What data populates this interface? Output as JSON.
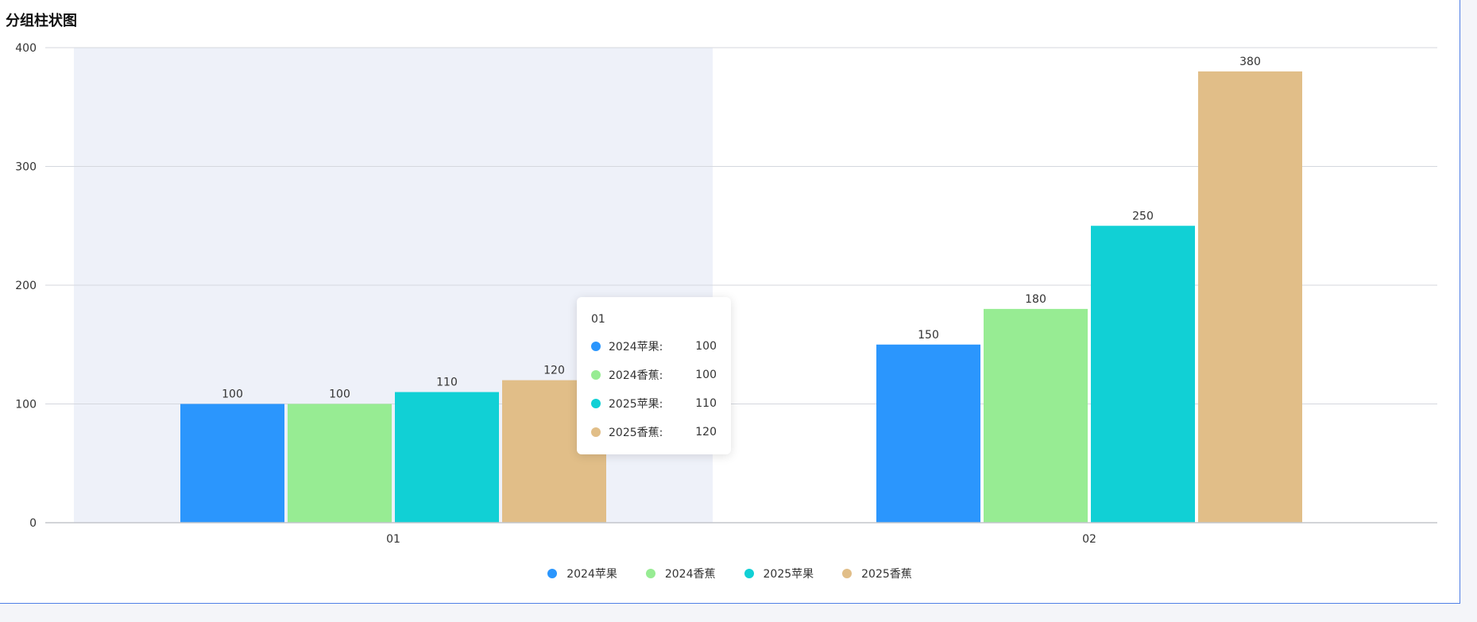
{
  "title": "分组柱状图",
  "colors": [
    "#2b96fd",
    "#97ec93",
    "#11d0d5",
    "#e1be88"
  ],
  "chart_data": {
    "type": "bar",
    "categories": [
      "01",
      "02"
    ],
    "series": [
      {
        "name": "2024苹果",
        "values": [
          100,
          150
        ]
      },
      {
        "name": "2024香蕉",
        "values": [
          100,
          180
        ]
      },
      {
        "name": "2025苹果",
        "values": [
          110,
          250
        ]
      },
      {
        "name": "2025香蕉",
        "values": [
          120,
          380
        ]
      }
    ],
    "ylim": [
      0,
      400
    ],
    "yticks": [
      0,
      100,
      200,
      300,
      400
    ],
    "grid": true,
    "legend_position": "bottom",
    "data_labels": true,
    "highlighted_category": "01"
  },
  "tooltip": {
    "title": "01",
    "rows": [
      {
        "name": "2024苹果:",
        "value": "100"
      },
      {
        "name": "2024香蕉:",
        "value": "100"
      },
      {
        "name": "2025苹果:",
        "value": "110"
      },
      {
        "name": "2025香蕉:",
        "value": "120"
      }
    ]
  }
}
